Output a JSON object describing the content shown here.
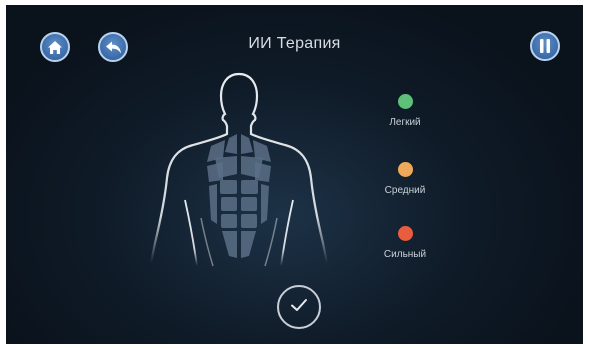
{
  "header": {
    "title": "ИИ Терапия",
    "home_icon": "home-icon",
    "back_icon": "back-arrow-icon",
    "pause_icon": "pause-icon"
  },
  "legend": {
    "light": {
      "label": "Легкий",
      "color": "#5fc07a"
    },
    "medium": {
      "label": "Средний",
      "color": "#f0a95a"
    },
    "strong": {
      "label": "Сильный",
      "color": "#e85d3d"
    }
  },
  "confirm": {
    "icon": "checkmark-icon"
  },
  "colors": {
    "background": "#0f1b28",
    "button_fill": "#3a6aa8",
    "button_border": "#b9d3ee",
    "body_outline": "#e8ecf0",
    "muscle_fill": "#5a6f86"
  }
}
